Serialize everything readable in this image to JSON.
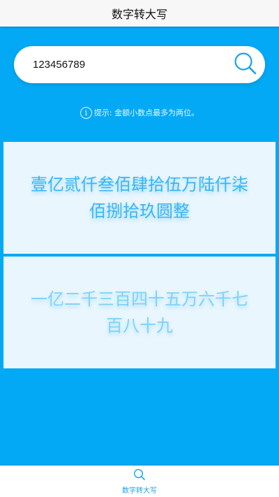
{
  "navbar": {
    "title": "数字转大写"
  },
  "search": {
    "value": "123456789",
    "button_icon": "search-icon"
  },
  "hint": {
    "icon": "info-icon",
    "text": "提示: 金额小数点最多为两位。"
  },
  "results": {
    "uppercase_amount": "壹亿贰仟叁佰肆拾伍万陆仟柒佰捌拾玖圆整",
    "chinese_numerals": "一亿二千三百四十五万六千七百八十九"
  },
  "tabbar": {
    "items": [
      {
        "label": "数字转大写",
        "icon": "search-icon"
      }
    ]
  },
  "colors": {
    "background": "#03a9f4",
    "card": "#eaf6fd",
    "accent": "#1aa3e8"
  }
}
